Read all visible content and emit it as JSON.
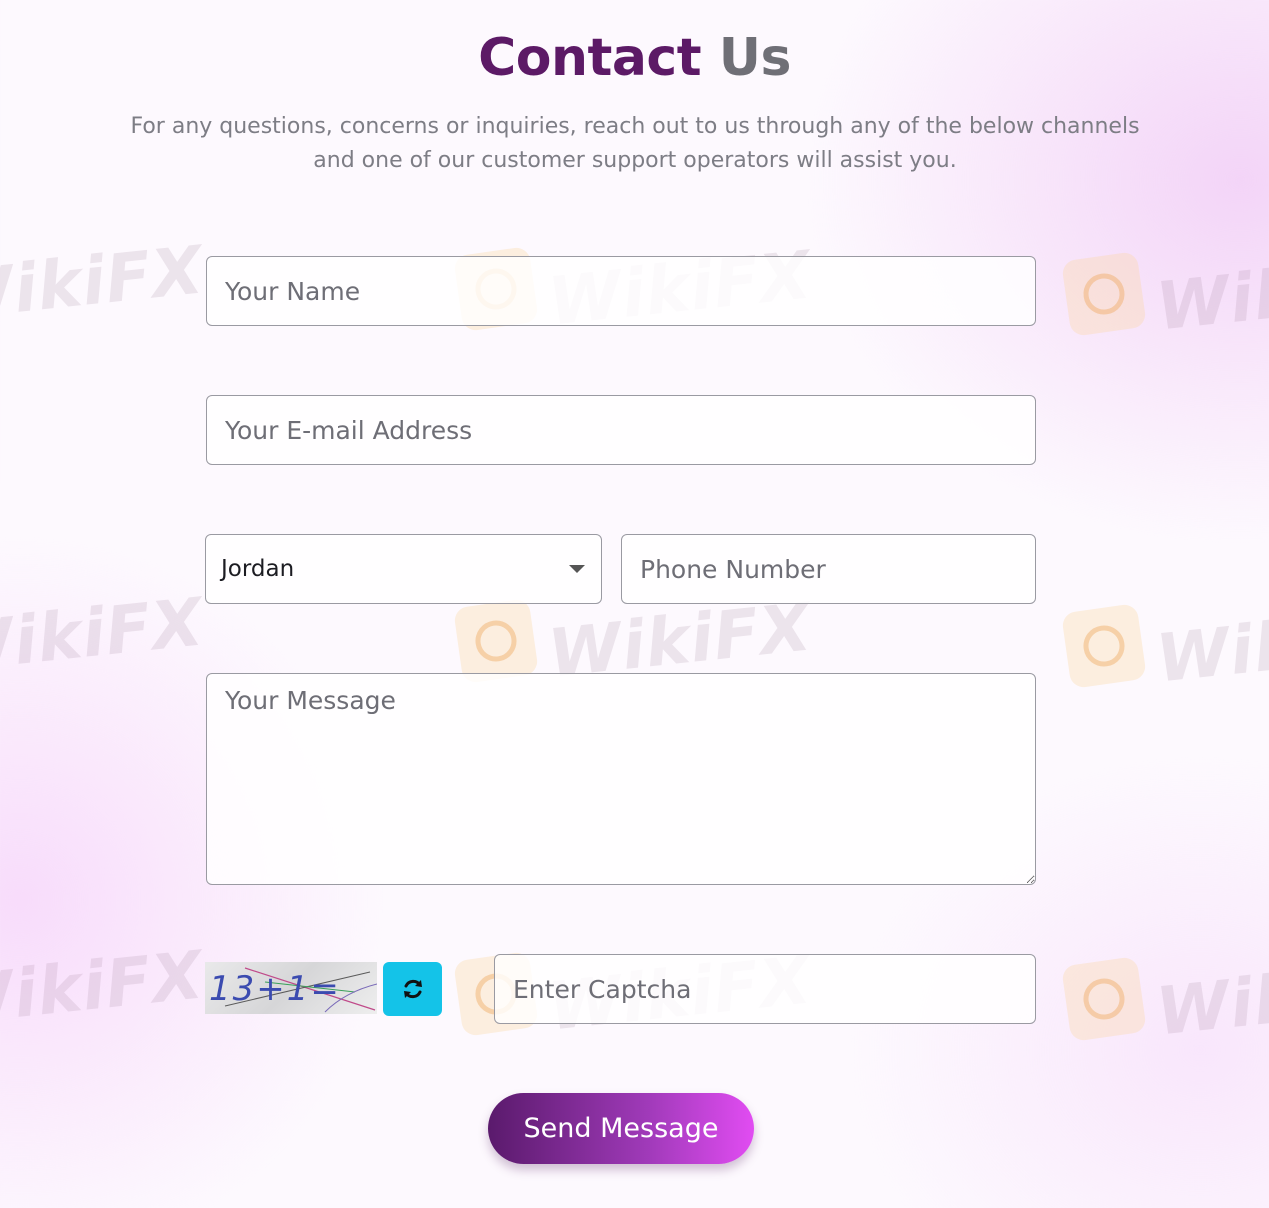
{
  "header": {
    "title_part1": "Contact",
    "title_part2": "Us",
    "subtitle_line1": "For any questions, concerns or inquiries, reach out to us through any of the below channels",
    "subtitle_line2": "and one of our customer support operators will assist you."
  },
  "form": {
    "name_placeholder": "Your Name",
    "email_placeholder": "Your E-mail Address",
    "country_selected": "Jordan",
    "phone_placeholder": "Phone Number",
    "message_placeholder": "Your Message",
    "captcha_text": "13+1=",
    "captcha_placeholder": "Enter Captcha",
    "send_label": "Send Message"
  },
  "watermark": {
    "text": "WikiFX"
  },
  "icons": {
    "dropdown": "caret-down-icon",
    "refresh": "refresh-icon",
    "watermark_logo": "wikifx-logo-icon"
  },
  "colors": {
    "title_primary": "#5c1a66",
    "title_secondary": "#6f6f76",
    "refresh_button": "#14c3e8",
    "send_button_start": "#5a1a6c",
    "send_button_end": "#e14cf2"
  }
}
